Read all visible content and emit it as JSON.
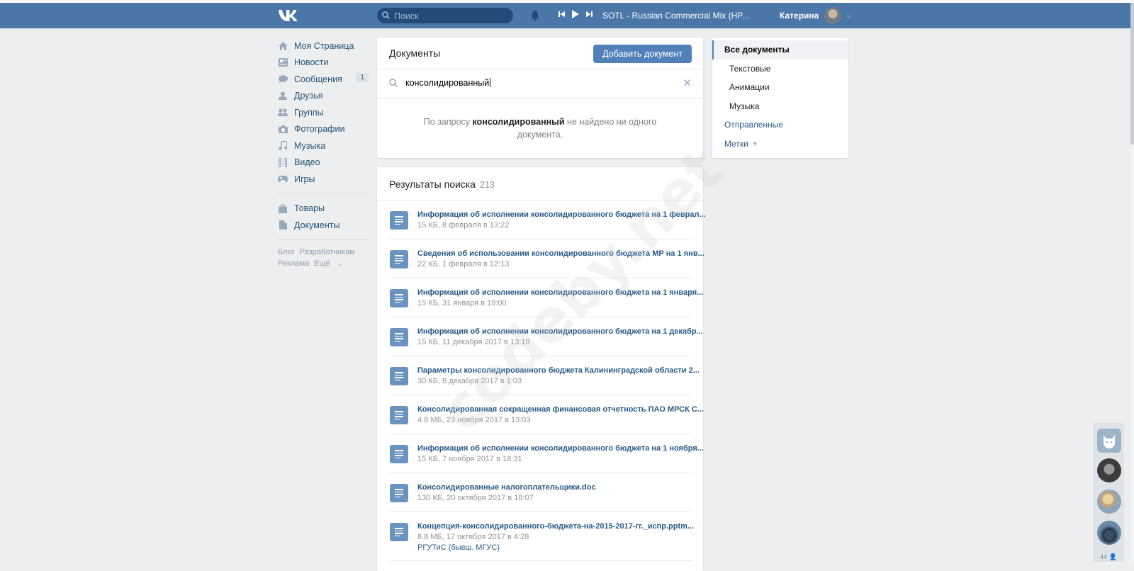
{
  "header": {
    "search_placeholder": "Поиск",
    "track": "SOTL - Russian Commercial Mix (HP...",
    "user_name": "Катерина"
  },
  "leftnav": {
    "items": [
      {
        "label": "Моя Страница",
        "icon": "home-icon"
      },
      {
        "label": "Новости",
        "icon": "news-icon"
      },
      {
        "label": "Сообщения",
        "icon": "messages-icon",
        "badge": "1"
      },
      {
        "label": "Друзья",
        "icon": "friends-icon"
      },
      {
        "label": "Группы",
        "icon": "groups-icon"
      },
      {
        "label": "Фотографии",
        "icon": "camera-icon"
      },
      {
        "label": "Музыка",
        "icon": "music-icon"
      },
      {
        "label": "Видео",
        "icon": "video-icon"
      },
      {
        "label": "Игры",
        "icon": "games-icon"
      },
      {
        "label": "Товары",
        "icon": "bag-icon"
      },
      {
        "label": "Документы",
        "icon": "document-icon"
      }
    ],
    "footer": [
      "Блог",
      "Разработчикам",
      "Реклама",
      "Ещё"
    ]
  },
  "docs": {
    "title": "Документы",
    "add_button": "Добавить документ",
    "query": "консолидированный",
    "noresult_before": "По запросу ",
    "noresult_query": "консолидированный",
    "noresult_after_line1": " не найдено ни одного",
    "noresult_line2": "документа."
  },
  "results": {
    "title": "Результаты поиска",
    "count": "213",
    "items": [
      {
        "name": "Информация об исполнении консолидированного бюджета на 1 феврал...",
        "meta": "15 КБ, 8 февраля в 13:22"
      },
      {
        "name": "Сведения об использовании консолидированного бюджета МР на 1 янв...",
        "meta": "22 КБ, 1 февраля в 12:13"
      },
      {
        "name": "Информация об исполнении консолидированного бюджета на 1 января...",
        "meta": "15 КБ, 31 января в 19:00"
      },
      {
        "name": "Информация об исполнении консолидированного бюджета на 1 декабр...",
        "meta": "15 КБ, 11 декабря 2017 в 13:19"
      },
      {
        "name": "Параметры консолидированного бюджета Калининградской области 2...",
        "meta": "30 КБ, 8 декабря 2017 в 1:03"
      },
      {
        "name": "Консолидированная сокращенная финансовая отчетность ПАО МРСК С...",
        "meta": "4.8 МБ, 23 ноября 2017 в 13:03"
      },
      {
        "name": "Информация об исполнении консолидированного бюджета на 1 ноября...",
        "meta": "15 КБ, 7 ноября 2017 в 18:31"
      },
      {
        "name": "Консолидированные налогоплательщики.doc",
        "meta": "130 КБ, 20 октября 2017 в 18:07"
      },
      {
        "name": "Концепция-консолидированного-бюджета-на-2015-2017-гг._испр.pptm...",
        "meta": "8.8 МБ, 17 октября 2017 в 4:28",
        "extra": "РГУТиС (бывш. МГУС)"
      }
    ]
  },
  "filters": {
    "all": "Все документы",
    "text": "Текстовые",
    "animations": "Анимации",
    "music": "Музыка",
    "sent": "Отправленные",
    "tags": "Метки"
  },
  "watermark": "codeby.net",
  "chat_count": "44",
  "colors": {
    "header": "#4a76a8",
    "link": "#2a5885",
    "button": "#5181b8"
  }
}
